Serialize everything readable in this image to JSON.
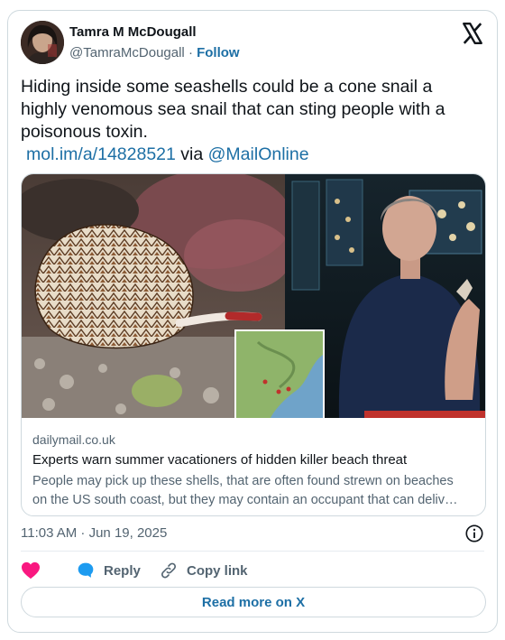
{
  "tweet": {
    "author_name": "Tamra M McDougall",
    "handle": "@TamraMcDougall",
    "separator": "·",
    "follow_label": "Follow",
    "text": "Hiding inside some seashells could be a cone snail a highly venomous sea snail that can sting people with a poisonous toxin.",
    "link_url": "mol.im/a/14828521",
    "via": "via",
    "mention": "@MailOnline",
    "timestamp": "11:03 AM · Jun 19, 2025"
  },
  "preview": {
    "domain": "dailymail.co.uk",
    "title": "Experts warn summer vacationers of hidden killer beach threat",
    "description_line1": "People may pick up these shells, that are often found strewn on beaches",
    "description_line2": "on the US south coast, but they may contain an occupant that can deliv…"
  },
  "actions": {
    "like_icon": "heart-icon",
    "reply_label": "Reply",
    "copy_label": "Copy link",
    "read_more_label": "Read more on X"
  },
  "colors": {
    "link": "#1d6fa5",
    "like": "#f91880",
    "muted": "#536471",
    "border": "#cfd9de"
  }
}
